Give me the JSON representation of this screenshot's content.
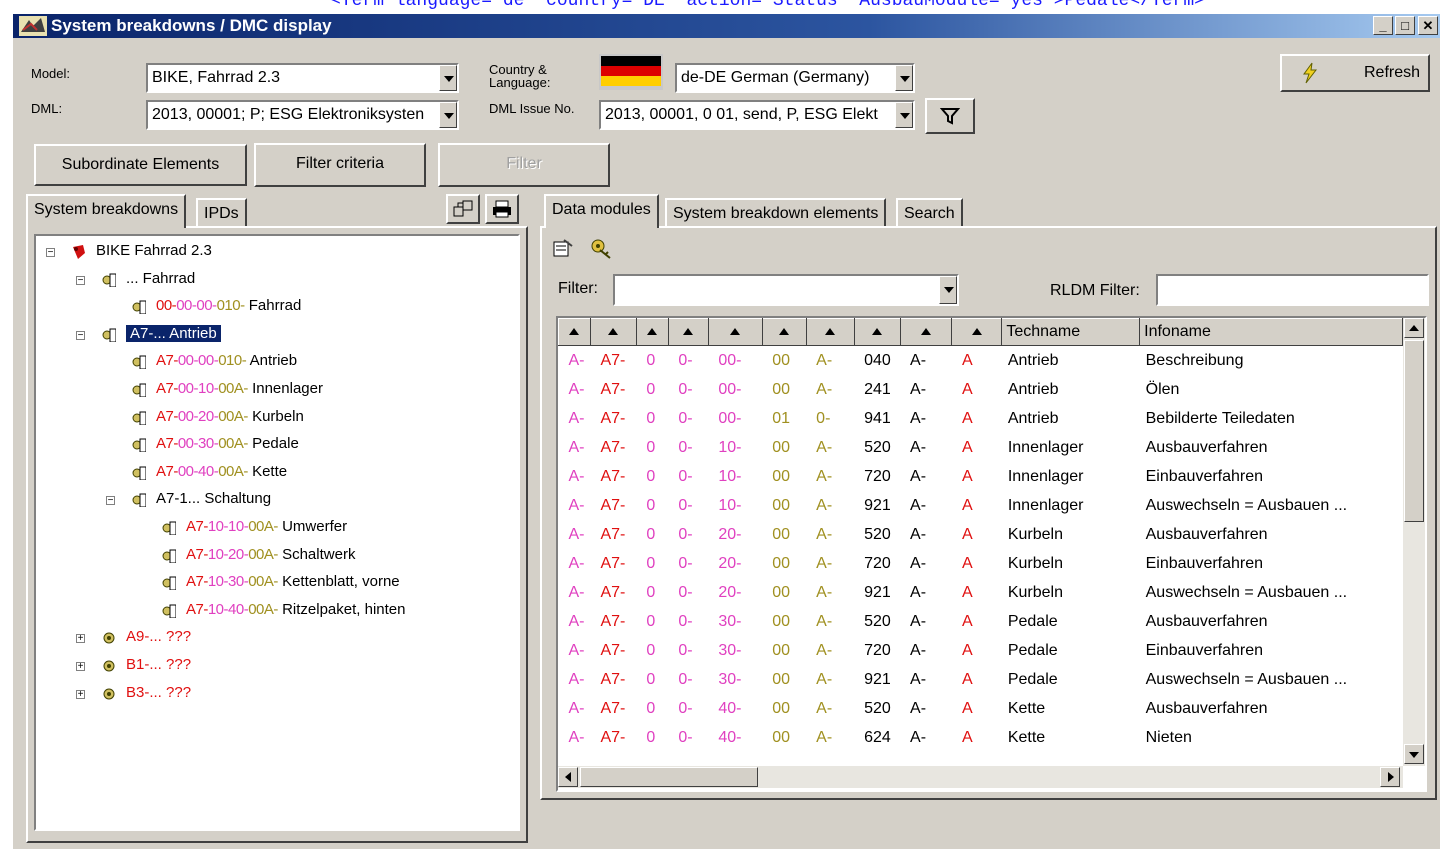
{
  "background_code": [
    "<Term language=\"de\" country=\"DE\" action=\"Status\" AusbauModule=\"yes\">Pedale</Term>"
  ],
  "window": {
    "title": "System breakdowns / DMC display",
    "min": "_",
    "max": "□",
    "close": "✕"
  },
  "header": {
    "model_label": "Model:",
    "model_value": "BIKE, Fahrrad 2.3",
    "dml_label": "DML:",
    "dml_value": "2013, 00001; P; ESG Elektroniksysten",
    "country_label": "Country &\nLanguage:",
    "country_value": "de-DE German (Germany)",
    "dml_issue_label": "DML Issue No.",
    "dml_issue_value": "2013, 00001, 0 01, send, P, ESG Elekt",
    "refresh_label": "Refresh"
  },
  "buttons": {
    "subordinate": "Subordinate Elements",
    "filter_criteria": "Filter criteria",
    "filter": "Filter"
  },
  "left_tabs": [
    "System breakdowns",
    "IPDs"
  ],
  "tree": [
    {
      "indent": 0,
      "code": "",
      "text": "BIKE Fahrrad 2.3",
      "exp": "-",
      "icon": "bike",
      "parts": []
    },
    {
      "indent": 1,
      "code": "",
      "text": "... Fahrrad",
      "exp": "-",
      "icon": "doc",
      "parts": []
    },
    {
      "indent": 2,
      "code": "",
      "text": "Fahrrad",
      "exp": "",
      "icon": "doc",
      "parts": [
        "00-",
        "00-",
        "00-",
        "010-"
      ]
    },
    {
      "indent": 1,
      "code": "",
      "text": "A7-... Antrieb",
      "exp": "-",
      "icon": "doc",
      "selected": true,
      "parts": []
    },
    {
      "indent": 2,
      "code": "",
      "text": "Antrieb",
      "exp": "",
      "icon": "doc",
      "parts": [
        "A7-",
        "00-",
        "00-",
        "010-"
      ]
    },
    {
      "indent": 2,
      "code": "",
      "text": "Innenlager",
      "exp": "",
      "icon": "doc",
      "parts": [
        "A7-",
        "00-",
        "10-",
        "00A-"
      ]
    },
    {
      "indent": 2,
      "code": "",
      "text": "Kurbeln",
      "exp": "",
      "icon": "doc",
      "parts": [
        "A7-",
        "00-",
        "20-",
        "00A-"
      ]
    },
    {
      "indent": 2,
      "code": "",
      "text": "Pedale",
      "exp": "",
      "icon": "doc",
      "parts": [
        "A7-",
        "00-",
        "30-",
        "00A-"
      ]
    },
    {
      "indent": 2,
      "code": "",
      "text": "Kette",
      "exp": "",
      "icon": "doc",
      "parts": [
        "A7-",
        "00-",
        "40-",
        "00A-"
      ]
    },
    {
      "indent": 2,
      "code": "",
      "text": "A7-1... Schaltung",
      "exp": "-",
      "icon": "doc",
      "parts": []
    },
    {
      "indent": 3,
      "code": "",
      "text": "Umwerfer",
      "exp": "",
      "icon": "doc",
      "parts": [
        "A7-",
        "10-",
        "10-",
        "00A-"
      ]
    },
    {
      "indent": 3,
      "code": "",
      "text": "Schaltwerk",
      "exp": "",
      "icon": "doc",
      "parts": [
        "A7-",
        "10-",
        "20-",
        "00A-"
      ]
    },
    {
      "indent": 3,
      "code": "",
      "text": "Kettenblatt, vorne",
      "exp": "",
      "icon": "doc",
      "parts": [
        "A7-",
        "10-",
        "30-",
        "00A-"
      ]
    },
    {
      "indent": 3,
      "code": "",
      "text": "Ritzelpaket, hinten",
      "exp": "",
      "icon": "doc",
      "parts": [
        "A7-",
        "10-",
        "40-",
        "00A-"
      ]
    },
    {
      "indent": 1,
      "code": "",
      "text": "A9-... ???",
      "exp": "+",
      "icon": "gear",
      "parts": []
    },
    {
      "indent": 1,
      "code": "",
      "text": "B1-... ???",
      "exp": "+",
      "icon": "gear",
      "parts": []
    },
    {
      "indent": 1,
      "code": "",
      "text": "B3-... ???",
      "exp": "+",
      "icon": "gear",
      "parts": []
    }
  ],
  "right_tabs": [
    "Data modules",
    "System breakdown elements",
    "Search"
  ],
  "filter": {
    "label": "Filter:",
    "rldm_label": "RLDM Filter:"
  },
  "grid": {
    "headers": [
      "",
      "",
      "",
      "",
      "",
      "",
      "",
      "",
      "",
      "",
      "Techname",
      "Infoname"
    ],
    "rows": [
      [
        "A-",
        "A7-",
        "0",
        "0-",
        "00-",
        "00",
        "A-",
        "040",
        "A-",
        "A",
        "Antrieb",
        "Beschreibung"
      ],
      [
        "A-",
        "A7-",
        "0",
        "0-",
        "00-",
        "00",
        "A-",
        "241",
        "A-",
        "A",
        "Antrieb",
        "Ölen"
      ],
      [
        "A-",
        "A7-",
        "0",
        "0-",
        "00-",
        "01",
        "0-",
        "941",
        "A-",
        "A",
        "Antrieb",
        "Bebilderte Teiledaten"
      ],
      [
        "A-",
        "A7-",
        "0",
        "0-",
        "10-",
        "00",
        "A-",
        "520",
        "A-",
        "A",
        "Innenlager",
        "Ausbauverfahren"
      ],
      [
        "A-",
        "A7-",
        "0",
        "0-",
        "10-",
        "00",
        "A-",
        "720",
        "A-",
        "A",
        "Innenlager",
        "Einbauverfahren"
      ],
      [
        "A-",
        "A7-",
        "0",
        "0-",
        "10-",
        "00",
        "A-",
        "921",
        "A-",
        "A",
        "Innenlager",
        "Auswechseln = Ausbauen ..."
      ],
      [
        "A-",
        "A7-",
        "0",
        "0-",
        "20-",
        "00",
        "A-",
        "520",
        "A-",
        "A",
        "Kurbeln",
        "Ausbauverfahren"
      ],
      [
        "A-",
        "A7-",
        "0",
        "0-",
        "20-",
        "00",
        "A-",
        "720",
        "A-",
        "A",
        "Kurbeln",
        "Einbauverfahren"
      ],
      [
        "A-",
        "A7-",
        "0",
        "0-",
        "20-",
        "00",
        "A-",
        "921",
        "A-",
        "A",
        "Kurbeln",
        "Auswechseln = Ausbauen ..."
      ],
      [
        "A-",
        "A7-",
        "0",
        "0-",
        "30-",
        "00",
        "A-",
        "520",
        "A-",
        "A",
        "Pedale",
        "Ausbauverfahren"
      ],
      [
        "A-",
        "A7-",
        "0",
        "0-",
        "30-",
        "00",
        "A-",
        "720",
        "A-",
        "A",
        "Pedale",
        "Einbauverfahren"
      ],
      [
        "A-",
        "A7-",
        "0",
        "0-",
        "30-",
        "00",
        "A-",
        "921",
        "A-",
        "A",
        "Pedale",
        "Auswechseln = Ausbauen ..."
      ],
      [
        "A-",
        "A7-",
        "0",
        "0-",
        "40-",
        "00",
        "A-",
        "520",
        "A-",
        "A",
        "Kette",
        "Ausbauverfahren"
      ],
      [
        "A-",
        "A7-",
        "0",
        "0-",
        "40-",
        "00",
        "A-",
        "624",
        "A-",
        "A",
        "Kette",
        "Nieten"
      ]
    ]
  },
  "colors": {
    "title_bar": "#0a246a",
    "pink": "#e040c0",
    "red": "#e01010",
    "olive": "#a09020",
    "selection": "#0a246a"
  }
}
